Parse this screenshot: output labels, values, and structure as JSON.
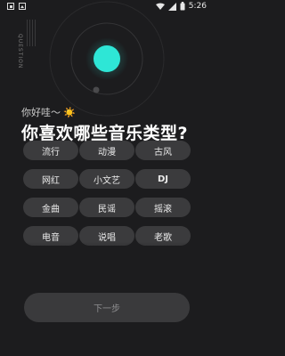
{
  "status_bar": {
    "time": "5:26"
  },
  "decor": {
    "vertical_label": "QUESTION"
  },
  "greeting": {
    "text": "你好哇～",
    "emoji": "☀️"
  },
  "title": "你喜欢哪些音乐类型?",
  "tags": [
    {
      "label": "流行"
    },
    {
      "label": "动漫"
    },
    {
      "label": "古风"
    },
    {
      "label": "网红"
    },
    {
      "label": "小文艺"
    },
    {
      "label": "DJ"
    },
    {
      "label": "金曲"
    },
    {
      "label": "民谣"
    },
    {
      "label": "摇滚"
    },
    {
      "label": "电音"
    },
    {
      "label": "说唱"
    },
    {
      "label": "老歌"
    }
  ],
  "button": {
    "next_label": "下一步"
  },
  "colors": {
    "accent": "#2ee6d6",
    "background": "#1c1c1e",
    "tag_bg": "#3b3b3d"
  }
}
